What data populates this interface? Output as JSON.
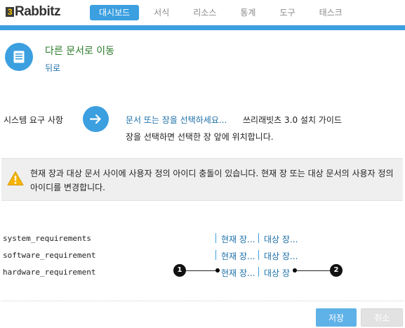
{
  "app": {
    "logo_num": "3",
    "logo_text": "Rabbitz"
  },
  "nav": {
    "tabs": [
      {
        "label": "대시보드",
        "active": true
      },
      {
        "label": "서식",
        "active": false
      },
      {
        "label": "리소스",
        "active": false
      },
      {
        "label": "통계",
        "active": false
      },
      {
        "label": "도구",
        "active": false
      },
      {
        "label": "태스크",
        "active": false
      }
    ]
  },
  "header": {
    "title": "다른 문서로 이동",
    "back_label": "뒤로",
    "icon": "document-icon"
  },
  "source": {
    "label": "시스템 요구 사항",
    "select_page_link": "문서 또는 장을 선택하세요...",
    "guide_title": "쓰리래빗츠 3.0 설치 가이드",
    "hint": "장을 선택하면 선택한 장 앞에 위치합니다."
  },
  "warning": {
    "icon": "warning-icon",
    "message": "현재 장과 대상 문서 사이에 사용자 정의 아이디 충돌이 있습니다. 현재 장 또는 대상 문서의 사용자 정의 아이디를 변경합니다."
  },
  "id_conflicts": [
    {
      "name": "system_requirements",
      "current_link": "현재 장...",
      "target_link": "대상 장..."
    },
    {
      "name": "software_requirement",
      "current_link": "현재 장...",
      "target_link": "대상 장..."
    },
    {
      "name": "hardware_requirement",
      "current_link": "현재 장...",
      "target_link": "대상 장"
    }
  ],
  "callouts": [
    {
      "number": "1"
    },
    {
      "number": "2"
    }
  ],
  "buttons": {
    "save": "저장",
    "cancel": "취소"
  },
  "colors": {
    "accent": "#3b9fe0",
    "link": "#1b6fa8",
    "title_green": "#2a7b2a",
    "warning_yellow": "#f5b400"
  }
}
